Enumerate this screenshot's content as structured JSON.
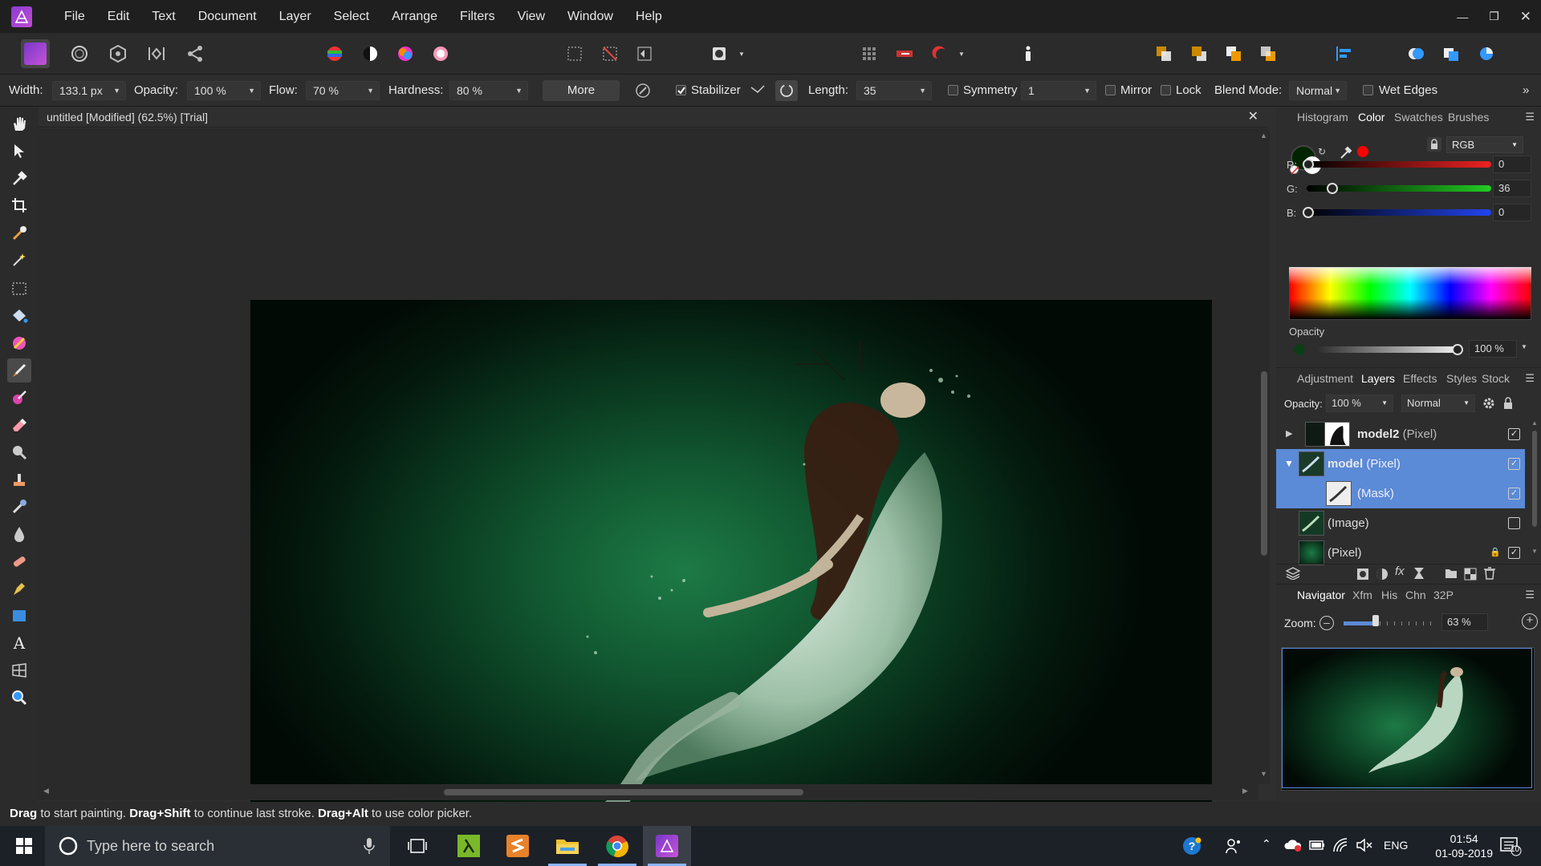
{
  "menubar": {
    "items": [
      "File",
      "Edit",
      "Text",
      "Document",
      "Layer",
      "Select",
      "Arrange",
      "Filters",
      "View",
      "Window",
      "Help"
    ]
  },
  "context": {
    "width_label": "Width:",
    "width_value": "133.1 px",
    "opacity_label": "Opacity:",
    "opacity_value": "100 %",
    "flow_label": "Flow:",
    "flow_value": "70 %",
    "hardness_label": "Hardness:",
    "hardness_value": "80 %",
    "more_label": "More",
    "stabilizer_label": "Stabilizer",
    "length_label": "Length:",
    "length_value": "35",
    "symmetry_label": "Symmetry",
    "symmetry_value": "1",
    "mirror_label": "Mirror",
    "lock_label": "Lock",
    "blend_label": "Blend Mode:",
    "blend_value": "Normal",
    "wet_edges_label": "Wet Edges"
  },
  "document": {
    "tab_title": "untitled [Modified] (62.5%) [Trial]"
  },
  "status": {
    "drag": "Drag",
    "t1": " to start painting. ",
    "drag_shift": "Drag+Shift",
    "t2": " to continue last stroke. ",
    "drag_alt": "Drag+Alt",
    "t3": " to use color picker."
  },
  "color_panel": {
    "tabs": [
      "Histogram",
      "Color",
      "Swatches",
      "Brushes"
    ],
    "selected_tab": "Color",
    "mode": "RGB",
    "r_label": "R:",
    "r_value": "0",
    "g_label": "G:",
    "g_value": "36",
    "b_label": "B:",
    "b_value": "0",
    "opacity_label": "Opacity",
    "opacity_value": "100 %",
    "primary_color": "#002400",
    "secondary_color": "#ff0000"
  },
  "layers_panel": {
    "tabs": [
      "Adjustment",
      "Layers",
      "Effects",
      "Styles",
      "Stock"
    ],
    "selected_tab": "Layers",
    "opacity_label": "Opacity:",
    "opacity_value": "100 %",
    "blend_value": "Normal",
    "layers": [
      {
        "name": "model2",
        "type": " (Pixel)",
        "visible": true,
        "selected": false
      },
      {
        "name": "model",
        "type": " (Pixel)",
        "visible": true,
        "selected": true
      },
      {
        "name": "",
        "type": "(Mask)",
        "visible": true,
        "selected": true
      },
      {
        "name": "",
        "type": "(Image)",
        "visible": false,
        "selected": false
      },
      {
        "name": "",
        "type": "(Pixel)",
        "visible": true,
        "selected": false
      }
    ]
  },
  "navigator_panel": {
    "tabs": [
      "Navigator",
      "Xfm",
      "His",
      "Chn",
      "32P"
    ],
    "selected_tab": "Navigator",
    "zoom_label": "Zoom:",
    "zoom_value": "63 %",
    "zoom_level": 0.35
  },
  "taskbar": {
    "search_placeholder": "Type here to search",
    "time": "01:54",
    "date": "01-09-2019",
    "language": "ENG",
    "notifications": "10"
  }
}
